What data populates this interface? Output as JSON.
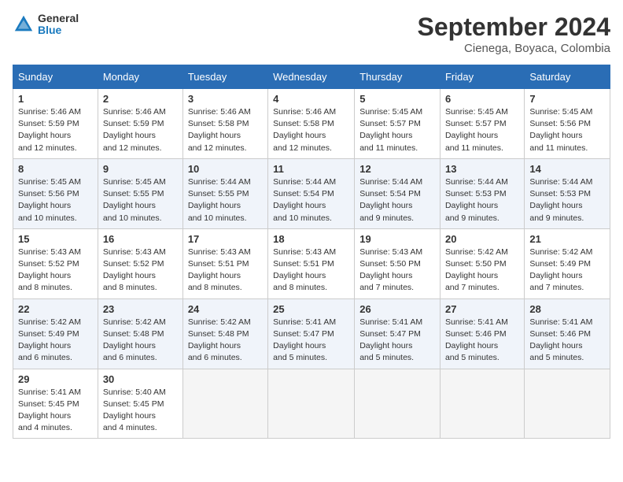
{
  "logo": {
    "line1": "General",
    "line2": "Blue"
  },
  "title": "September 2024",
  "location": "Cienega, Boyaca, Colombia",
  "weekdays": [
    "Sunday",
    "Monday",
    "Tuesday",
    "Wednesday",
    "Thursday",
    "Friday",
    "Saturday"
  ],
  "weeks": [
    [
      {
        "day": "1",
        "sunrise": "5:46 AM",
        "sunset": "5:59 PM",
        "daylight": "12 hours and 12 minutes."
      },
      {
        "day": "2",
        "sunrise": "5:46 AM",
        "sunset": "5:59 PM",
        "daylight": "12 hours and 12 minutes."
      },
      {
        "day": "3",
        "sunrise": "5:46 AM",
        "sunset": "5:58 PM",
        "daylight": "12 hours and 12 minutes."
      },
      {
        "day": "4",
        "sunrise": "5:46 AM",
        "sunset": "5:58 PM",
        "daylight": "12 hours and 12 minutes."
      },
      {
        "day": "5",
        "sunrise": "5:45 AM",
        "sunset": "5:57 PM",
        "daylight": "12 hours and 11 minutes."
      },
      {
        "day": "6",
        "sunrise": "5:45 AM",
        "sunset": "5:57 PM",
        "daylight": "12 hours and 11 minutes."
      },
      {
        "day": "7",
        "sunrise": "5:45 AM",
        "sunset": "5:56 PM",
        "daylight": "12 hours and 11 minutes."
      }
    ],
    [
      {
        "day": "8",
        "sunrise": "5:45 AM",
        "sunset": "5:56 PM",
        "daylight": "12 hours and 10 minutes."
      },
      {
        "day": "9",
        "sunrise": "5:45 AM",
        "sunset": "5:55 PM",
        "daylight": "12 hours and 10 minutes."
      },
      {
        "day": "10",
        "sunrise": "5:44 AM",
        "sunset": "5:55 PM",
        "daylight": "12 hours and 10 minutes."
      },
      {
        "day": "11",
        "sunrise": "5:44 AM",
        "sunset": "5:54 PM",
        "daylight": "12 hours and 10 minutes."
      },
      {
        "day": "12",
        "sunrise": "5:44 AM",
        "sunset": "5:54 PM",
        "daylight": "12 hours and 9 minutes."
      },
      {
        "day": "13",
        "sunrise": "5:44 AM",
        "sunset": "5:53 PM",
        "daylight": "12 hours and 9 minutes."
      },
      {
        "day": "14",
        "sunrise": "5:44 AM",
        "sunset": "5:53 PM",
        "daylight": "12 hours and 9 minutes."
      }
    ],
    [
      {
        "day": "15",
        "sunrise": "5:43 AM",
        "sunset": "5:52 PM",
        "daylight": "12 hours and 8 minutes."
      },
      {
        "day": "16",
        "sunrise": "5:43 AM",
        "sunset": "5:52 PM",
        "daylight": "12 hours and 8 minutes."
      },
      {
        "day": "17",
        "sunrise": "5:43 AM",
        "sunset": "5:51 PM",
        "daylight": "12 hours and 8 minutes."
      },
      {
        "day": "18",
        "sunrise": "5:43 AM",
        "sunset": "5:51 PM",
        "daylight": "12 hours and 8 minutes."
      },
      {
        "day": "19",
        "sunrise": "5:43 AM",
        "sunset": "5:50 PM",
        "daylight": "12 hours and 7 minutes."
      },
      {
        "day": "20",
        "sunrise": "5:42 AM",
        "sunset": "5:50 PM",
        "daylight": "12 hours and 7 minutes."
      },
      {
        "day": "21",
        "sunrise": "5:42 AM",
        "sunset": "5:49 PM",
        "daylight": "12 hours and 7 minutes."
      }
    ],
    [
      {
        "day": "22",
        "sunrise": "5:42 AM",
        "sunset": "5:49 PM",
        "daylight": "12 hours and 6 minutes."
      },
      {
        "day": "23",
        "sunrise": "5:42 AM",
        "sunset": "5:48 PM",
        "daylight": "12 hours and 6 minutes."
      },
      {
        "day": "24",
        "sunrise": "5:42 AM",
        "sunset": "5:48 PM",
        "daylight": "12 hours and 6 minutes."
      },
      {
        "day": "25",
        "sunrise": "5:41 AM",
        "sunset": "5:47 PM",
        "daylight": "12 hours and 5 minutes."
      },
      {
        "day": "26",
        "sunrise": "5:41 AM",
        "sunset": "5:47 PM",
        "daylight": "12 hours and 5 minutes."
      },
      {
        "day": "27",
        "sunrise": "5:41 AM",
        "sunset": "5:46 PM",
        "daylight": "12 hours and 5 minutes."
      },
      {
        "day": "28",
        "sunrise": "5:41 AM",
        "sunset": "5:46 PM",
        "daylight": "12 hours and 5 minutes."
      }
    ],
    [
      {
        "day": "29",
        "sunrise": "5:41 AM",
        "sunset": "5:45 PM",
        "daylight": "12 hours and 4 minutes."
      },
      {
        "day": "30",
        "sunrise": "5:40 AM",
        "sunset": "5:45 PM",
        "daylight": "12 hours and 4 minutes."
      },
      null,
      null,
      null,
      null,
      null
    ]
  ]
}
